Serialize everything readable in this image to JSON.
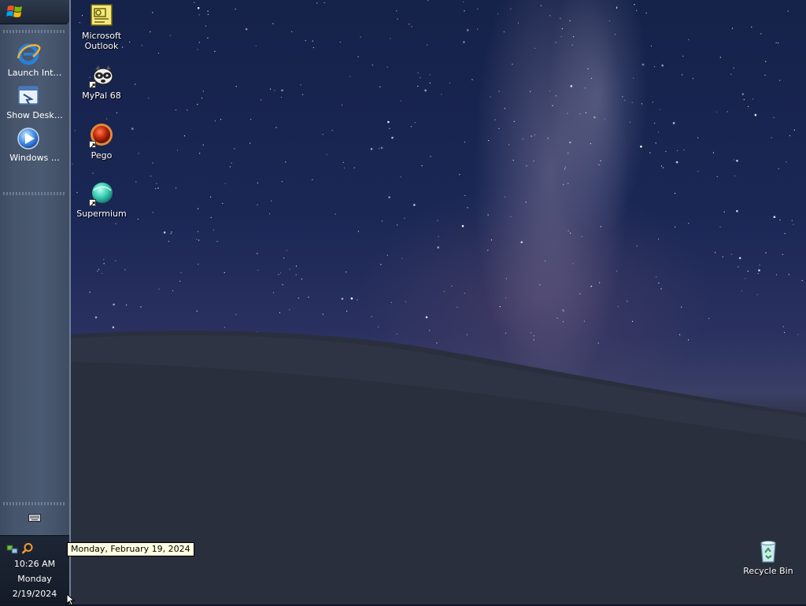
{
  "taskbar": {
    "start_button": {
      "icon": "windows-flag-icon"
    },
    "quick_launch": [
      {
        "label": "Launch Int…",
        "icon": "internet-explorer-icon"
      },
      {
        "label": "Show Desk…",
        "icon": "show-desktop-icon"
      },
      {
        "label": "Windows …",
        "icon": "windows-media-player-icon"
      }
    ],
    "keyboard_icon": "keyboard-icon",
    "tray": {
      "icons": [
        "network-icon",
        "search-icon"
      ],
      "clock": {
        "time": "10:26 AM",
        "day": "Monday",
        "date": "2/19/2024"
      }
    }
  },
  "desktop": {
    "icons": [
      {
        "label": "Microsoft Outlook",
        "icon": "outlook-icon",
        "shortcut": false
      },
      {
        "label": "MyPal 68",
        "icon": "mypal-icon",
        "shortcut": true
      },
      {
        "label": "Pego",
        "icon": "pego-icon",
        "shortcut": true
      },
      {
        "label": "Supermium",
        "icon": "supermium-icon",
        "shortcut": true
      },
      {
        "label": "Recycle Bin",
        "icon": "recycle-bin-icon",
        "shortcut": false
      }
    ]
  },
  "tooltip": {
    "text": "Monday, February 19, 2024"
  },
  "colors": {
    "taskbar": "#46556c",
    "tooltip_bg": "#ffffe1",
    "sky": "#1a2755",
    "ground": "#252a38"
  }
}
